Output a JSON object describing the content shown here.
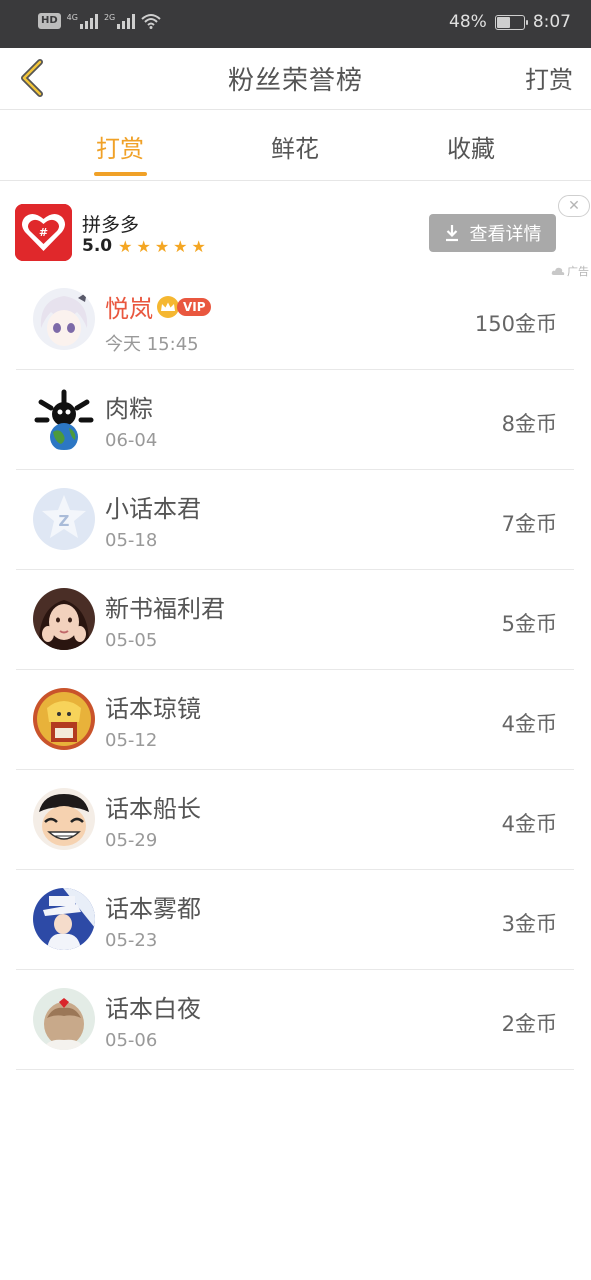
{
  "status_bar": {
    "hd": "HD",
    "net1": "4G",
    "net2": "2G",
    "battery_percent": "48%",
    "battery_level": 0.48,
    "time": "8:07"
  },
  "header": {
    "title": "粉丝荣誉榜",
    "right_action": "打赏"
  },
  "tabs": [
    {
      "label": "打赏",
      "active": true
    },
    {
      "label": "鲜花",
      "active": false
    },
    {
      "label": "收藏",
      "active": false
    }
  ],
  "ad": {
    "app_name": "拼多多",
    "rating": "5.0",
    "stars": 5,
    "button_label": "查看详情",
    "close_glyph": "✕",
    "ad_label": "广告",
    "logo_color": "#e0282b"
  },
  "fans": [
    {
      "name": "悦岚",
      "vip": true,
      "vip_label": "VIP",
      "date": "今天 15:45",
      "amount": "150金币"
    },
    {
      "name": "肉粽",
      "vip": false,
      "date": "06-04",
      "amount": "8金币"
    },
    {
      "name": "小话本君",
      "vip": false,
      "date": "05-18",
      "amount": "7金币"
    },
    {
      "name": "新书福利君",
      "vip": false,
      "date": "05-05",
      "amount": "5金币"
    },
    {
      "name": "话本琼镜",
      "vip": false,
      "date": "05-12",
      "amount": "4金币"
    },
    {
      "name": "话本船长",
      "vip": false,
      "date": "05-29",
      "amount": "4金币"
    },
    {
      "name": "话本雾都",
      "vip": false,
      "date": "05-23",
      "amount": "3金币"
    },
    {
      "name": "话本白夜",
      "vip": false,
      "date": "05-06",
      "amount": "2金币"
    }
  ],
  "colors": {
    "accent": "#f0a127",
    "vip": "#e9573f"
  }
}
